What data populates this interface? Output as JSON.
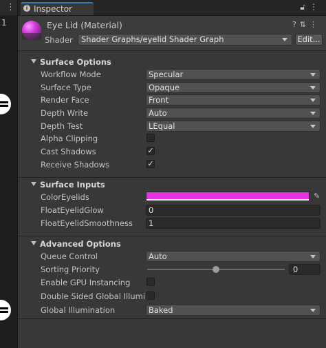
{
  "left_panel": {
    "kebab": "⋮",
    "number": "1"
  },
  "tabbar": {
    "tab_label": "Inspector",
    "info_glyph": "i",
    "lock_icon": "lock-icon",
    "menu_glyph": "⋮"
  },
  "header": {
    "title": "Eye Lid (Material)",
    "help_glyph": "?",
    "settings_glyph": "⇅",
    "menu_glyph": "⋮",
    "shader_label": "Shader",
    "shader_value": "Shader Graphs/eyelid Shader Graph",
    "edit_label": "Edit..."
  },
  "surface_options": {
    "title": "Surface Options",
    "rows": [
      {
        "label": "Workflow Mode",
        "value": "Specular"
      },
      {
        "label": "Surface Type",
        "value": "Opaque"
      },
      {
        "label": "Render Face",
        "value": "Front"
      },
      {
        "label": "Depth Write",
        "value": "Auto"
      },
      {
        "label": "Depth Test",
        "value": "LEqual"
      }
    ],
    "alpha_clipping": {
      "label": "Alpha Clipping",
      "checked": false
    },
    "cast_shadows": {
      "label": "Cast Shadows",
      "checked": true,
      "mark": "✓"
    },
    "receive_shadows": {
      "label": "Receive Shadows",
      "checked": true,
      "mark": "✓"
    }
  },
  "surface_inputs": {
    "title": "Surface Inputs",
    "color_eyelids": {
      "label": "ColorEyelids",
      "color": "#e632e6"
    },
    "eyelid_glow": {
      "label": "FloatEyelidGlow",
      "value": "0"
    },
    "eyelid_smoothness": {
      "label": "FloatEyelidSmoothness",
      "value": "1"
    }
  },
  "advanced_options": {
    "title": "Advanced Options",
    "queue_control": {
      "label": "Queue Control",
      "value": "Auto"
    },
    "sorting_priority": {
      "label": "Sorting Priority",
      "value": "0",
      "slider_fraction": 0.5
    },
    "gpu_instancing": {
      "label": "Enable GPU Instancing",
      "checked": false
    },
    "double_sided_gi": {
      "label": "Double Sided Global Illuminati",
      "checked": false
    },
    "global_illumination": {
      "label": "Global Illumination",
      "value": "Baked"
    }
  },
  "colors": {
    "accent_tab": "#3a79bb",
    "panel_bg": "#383838"
  }
}
